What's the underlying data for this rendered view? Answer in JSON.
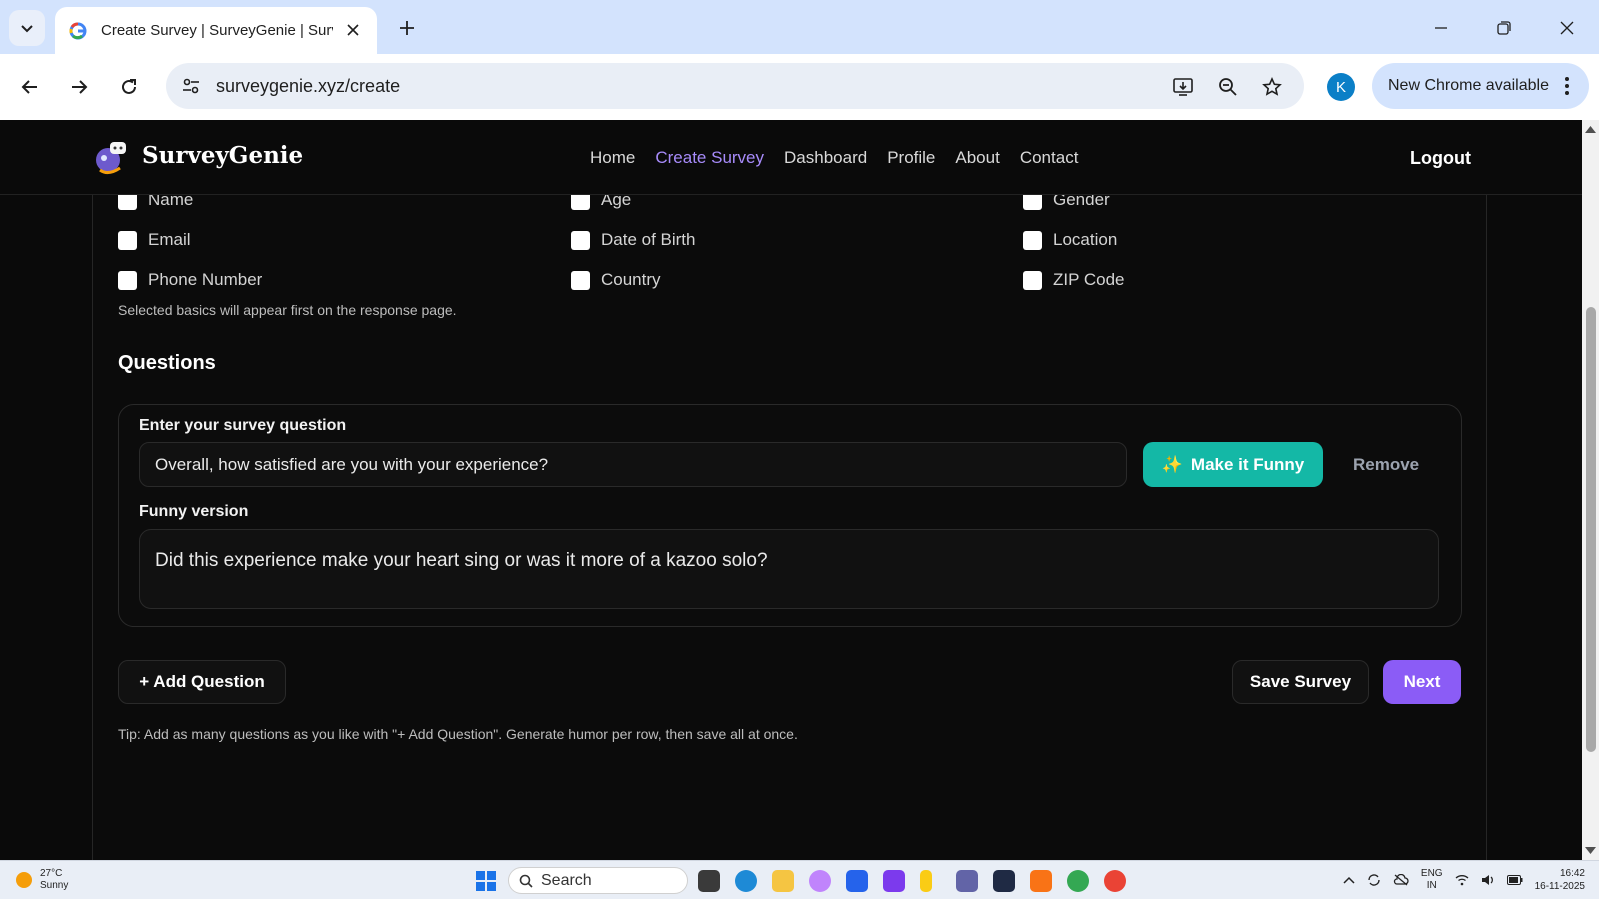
{
  "browser": {
    "tab_title": "Create Survey | SurveyGenie | Surv",
    "url": "surveygenie.xyz/create",
    "profile_initial": "K",
    "update_label": "New Chrome available"
  },
  "site": {
    "brand": "SurveyGenie",
    "nav": [
      "Home",
      "Create Survey",
      "Dashboard",
      "Profile",
      "About",
      "Contact"
    ],
    "active_nav": "Create Survey",
    "logout": "Logout"
  },
  "basics": {
    "fields": [
      [
        "Name",
        "Age",
        "Gender"
      ],
      [
        "Email",
        "Date of Birth",
        "Location"
      ],
      [
        "Phone Number",
        "Country",
        "ZIP Code"
      ]
    ],
    "note": "Selected basics will appear first on the response page."
  },
  "questions": {
    "title": "Questions",
    "item": {
      "label": "Enter your survey question",
      "value": "Overall, how satisfied are you with your experience?",
      "funny_button": "Make it Funny",
      "remove_button": "Remove",
      "funny_label": "Funny version",
      "funny_value": "Did this experience make your heart sing or was it more of a kazoo solo?"
    }
  },
  "actions": {
    "add_question": "+ Add Question",
    "save": "Save Survey",
    "next": "Next",
    "tip": "Tip: Add as many questions as you like with \"+ Add Question\". Generate humor per row, then save all at once."
  },
  "taskbar": {
    "temp": "27°C",
    "condition": "Sunny",
    "search": "Search",
    "lang": "ENG",
    "region": "IN",
    "time": "16:42",
    "date": "16-11-2025"
  },
  "colors": {
    "accent": "#8b5cf6",
    "active_nav": "#a78bfa",
    "funny_button": "#14b8a6"
  }
}
